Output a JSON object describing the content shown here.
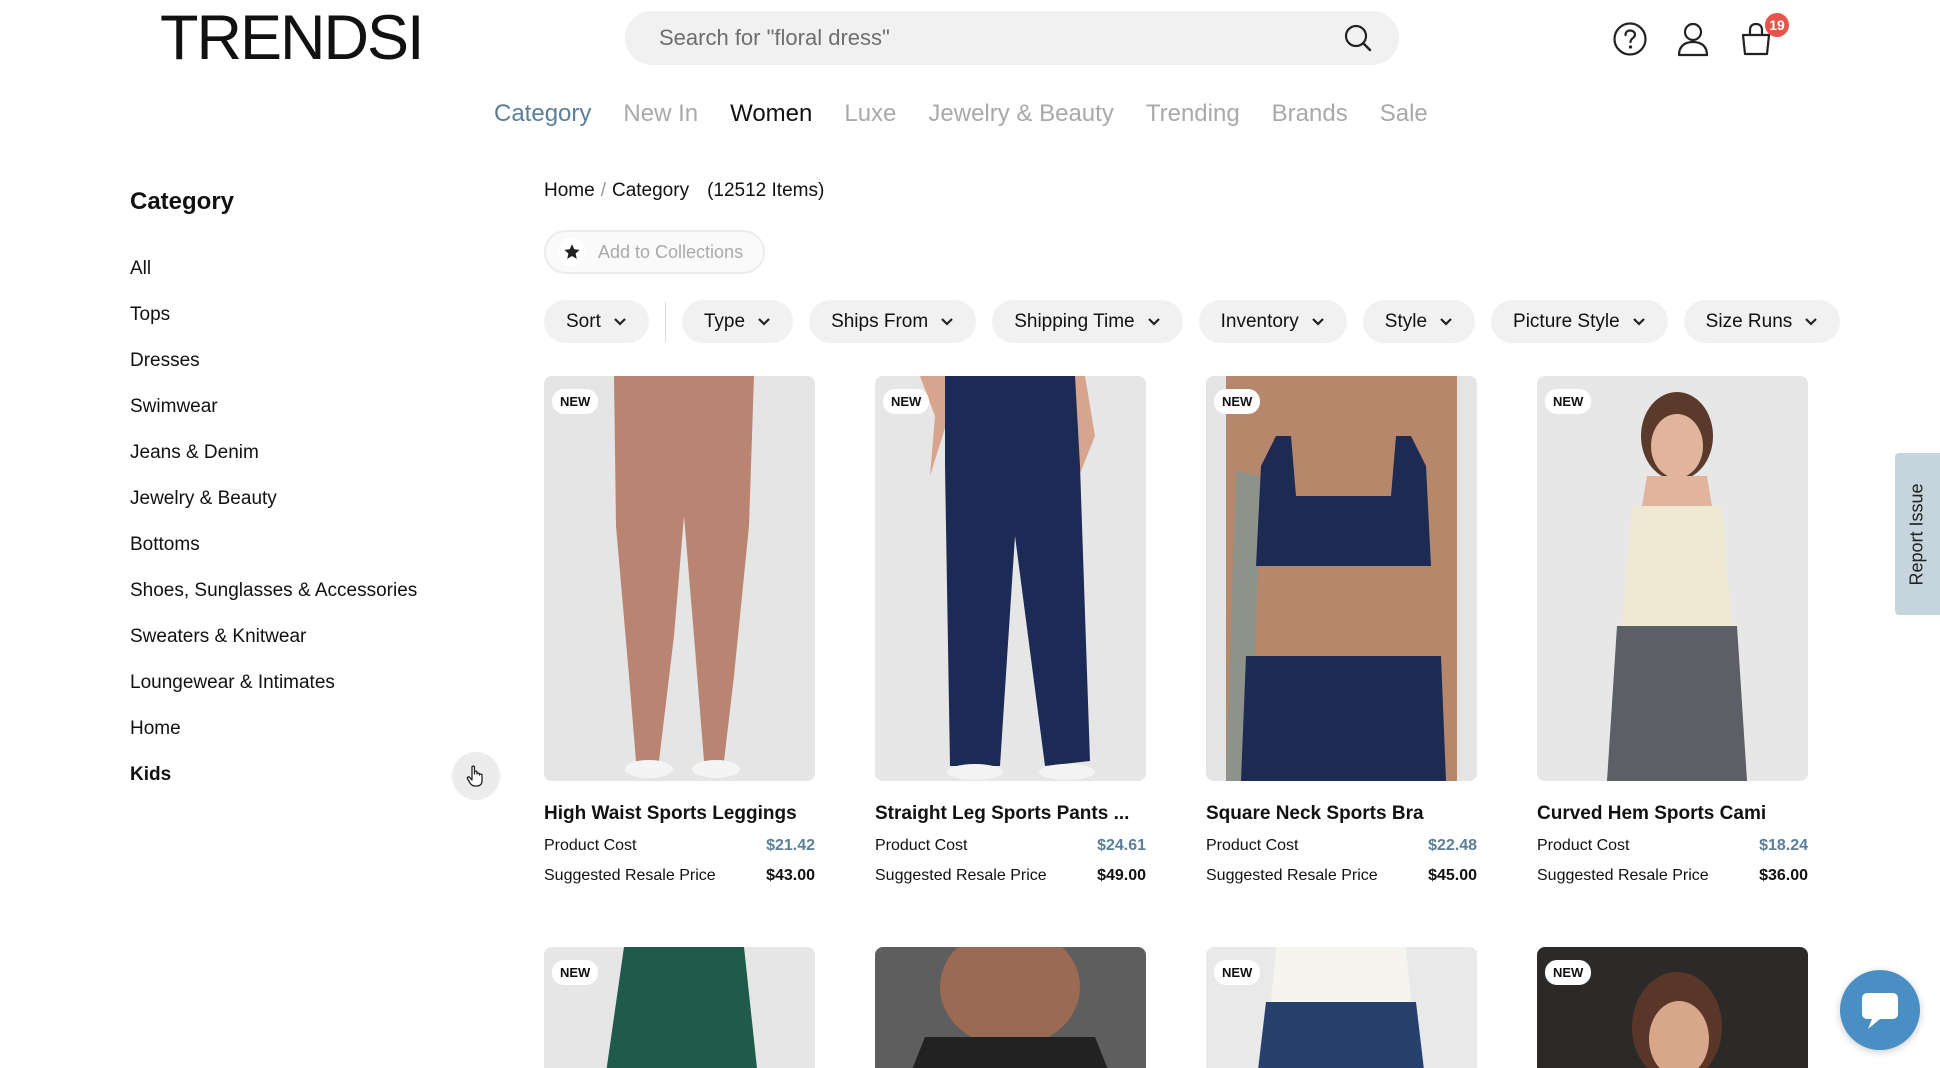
{
  "header": {
    "logo": "TRENDSI",
    "search_placeholder": "Search for \"floral dress\"",
    "cart_count": "19"
  },
  "topnav": [
    {
      "label": "Category"
    },
    {
      "label": "New In"
    },
    {
      "label": "Women"
    },
    {
      "label": "Luxe"
    },
    {
      "label": "Jewelry & Beauty"
    },
    {
      "label": "Trending"
    },
    {
      "label": "Brands"
    },
    {
      "label": "Sale"
    }
  ],
  "sidebar": {
    "title": "Category",
    "items": [
      {
        "label": "All"
      },
      {
        "label": "Tops"
      },
      {
        "label": "Dresses"
      },
      {
        "label": "Swimwear"
      },
      {
        "label": "Jeans & Denim"
      },
      {
        "label": "Jewelry & Beauty"
      },
      {
        "label": "Bottoms"
      },
      {
        "label": "Shoes, Sunglasses & Accessories"
      },
      {
        "label": "Sweaters & Knitwear"
      },
      {
        "label": "Loungewear & Intimates"
      },
      {
        "label": "Home"
      },
      {
        "label": "Kids"
      }
    ]
  },
  "breadcrumb": {
    "home": "Home",
    "sep": "/",
    "current": "Category",
    "count": "(12512 Items)"
  },
  "collection_button": "Add to Collections",
  "filters": [
    {
      "label": "Sort"
    },
    {
      "label": "Type"
    },
    {
      "label": "Ships From"
    },
    {
      "label": "Shipping Time"
    },
    {
      "label": "Inventory"
    },
    {
      "label": "Style"
    },
    {
      "label": "Picture Style"
    },
    {
      "label": "Size Runs"
    }
  ],
  "product_labels": {
    "badge": "NEW",
    "cost_label": "Product Cost",
    "resale_label": "Suggested Resale Price"
  },
  "products": [
    {
      "title": "High Waist Sports Leggings",
      "cost": "$21.42",
      "resale": "$43.00",
      "new": true
    },
    {
      "title": "Straight Leg Sports Pants ...",
      "cost": "$24.61",
      "resale": "$49.00",
      "new": true
    },
    {
      "title": "Square Neck Sports Bra",
      "cost": "$22.48",
      "resale": "$45.00",
      "new": true
    },
    {
      "title": "Curved Hem Sports Cami",
      "cost": "$18.24",
      "resale": "$36.00",
      "new": true
    }
  ],
  "products_row2": [
    {
      "new": true
    },
    {
      "new": false
    },
    {
      "new": true
    },
    {
      "new": true
    }
  ],
  "report_issue": "Report Issue",
  "colors": {
    "accent": "#5b7f9a",
    "badge_red": "#e8534a",
    "chat_blue": "#4a8fc4"
  }
}
